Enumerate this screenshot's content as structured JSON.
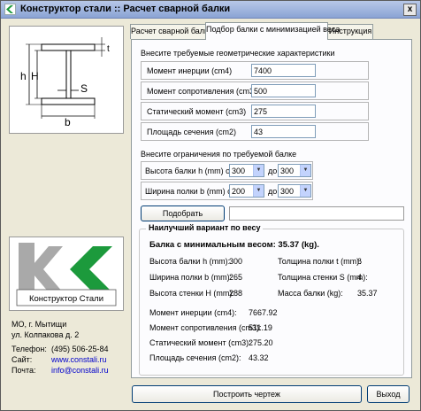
{
  "window": {
    "title": "Конструктор стали :: Расчет сварной балки",
    "close_label": "x"
  },
  "drawing_labels": {
    "h": "h",
    "H": "H",
    "S": "S",
    "b": "b",
    "t": "t"
  },
  "logo": {
    "text": "Конструктор Стали"
  },
  "contacts": {
    "address1": "МО, г. Мытищи",
    "address2": "ул. Колпакова д. 2",
    "phone_label": "Телефон:",
    "phone": "(495) 506-25-84",
    "site_label": "Сайт:",
    "site": "www.constali.ru",
    "mail_label": "Почта:",
    "mail": "info@constali.ru"
  },
  "tabs": [
    "Расчет сварной балки",
    "Подбор балки с минимизацией веса",
    "Инструкция"
  ],
  "geometry": {
    "title": "Внесите требуемые геометрические характеристики",
    "rows": [
      {
        "label": "Момент инерции (cm4)",
        "value": "7400"
      },
      {
        "label": "Момент сопротивления (cm3)",
        "value": "500"
      },
      {
        "label": "Статический момент (cm3)",
        "value": "275"
      },
      {
        "label": "Площадь сечения (cm2)",
        "value": "43"
      }
    ]
  },
  "constraints": {
    "title": "Внесите ограничения по требуемой балке",
    "height": {
      "label": "Высота балки h (mm) от",
      "from": "300",
      "to_label": "до",
      "to": "300"
    },
    "width": {
      "label": "Ширина полки b (mm) от",
      "from": "200",
      "to_label": "до",
      "to": "300"
    }
  },
  "select_button": "Подобрать",
  "progress": 0,
  "result": {
    "legend": "Наилучший вариант по весу",
    "headline": "Балка с минимальным весом: 35.37 (kg).",
    "left": [
      {
        "label": "Высота балки h (mm):",
        "value": "300"
      },
      {
        "label": "Ширина полки b (mm):",
        "value": "265"
      },
      {
        "label": "Высота стенки H (mm):",
        "value": "288"
      }
    ],
    "right": [
      {
        "label": "Толщина полки t (mm):",
        "value": "6"
      },
      {
        "label": "Толщина стенки S (mm):",
        "value": "4"
      },
      {
        "label": "Масса балки (kg):",
        "value": "35.37"
      }
    ],
    "bottom": [
      {
        "label": "Момент инерции (cm4):",
        "value": "7667.92"
      },
      {
        "label": "Момент сопротивления (cm3):",
        "value": "511.19"
      },
      {
        "label": "Статический момент (cm3):",
        "value": "275.20"
      },
      {
        "label": "Площадь сечения (cm2):",
        "value": "43.32"
      }
    ]
  },
  "footer": {
    "draw_button": "Построить чертеж",
    "exit_button": "Выход"
  },
  "colors": {
    "accent_green": "#1c9a3c",
    "logo_gray": "#a9a9a9",
    "link": "#0000cc"
  }
}
